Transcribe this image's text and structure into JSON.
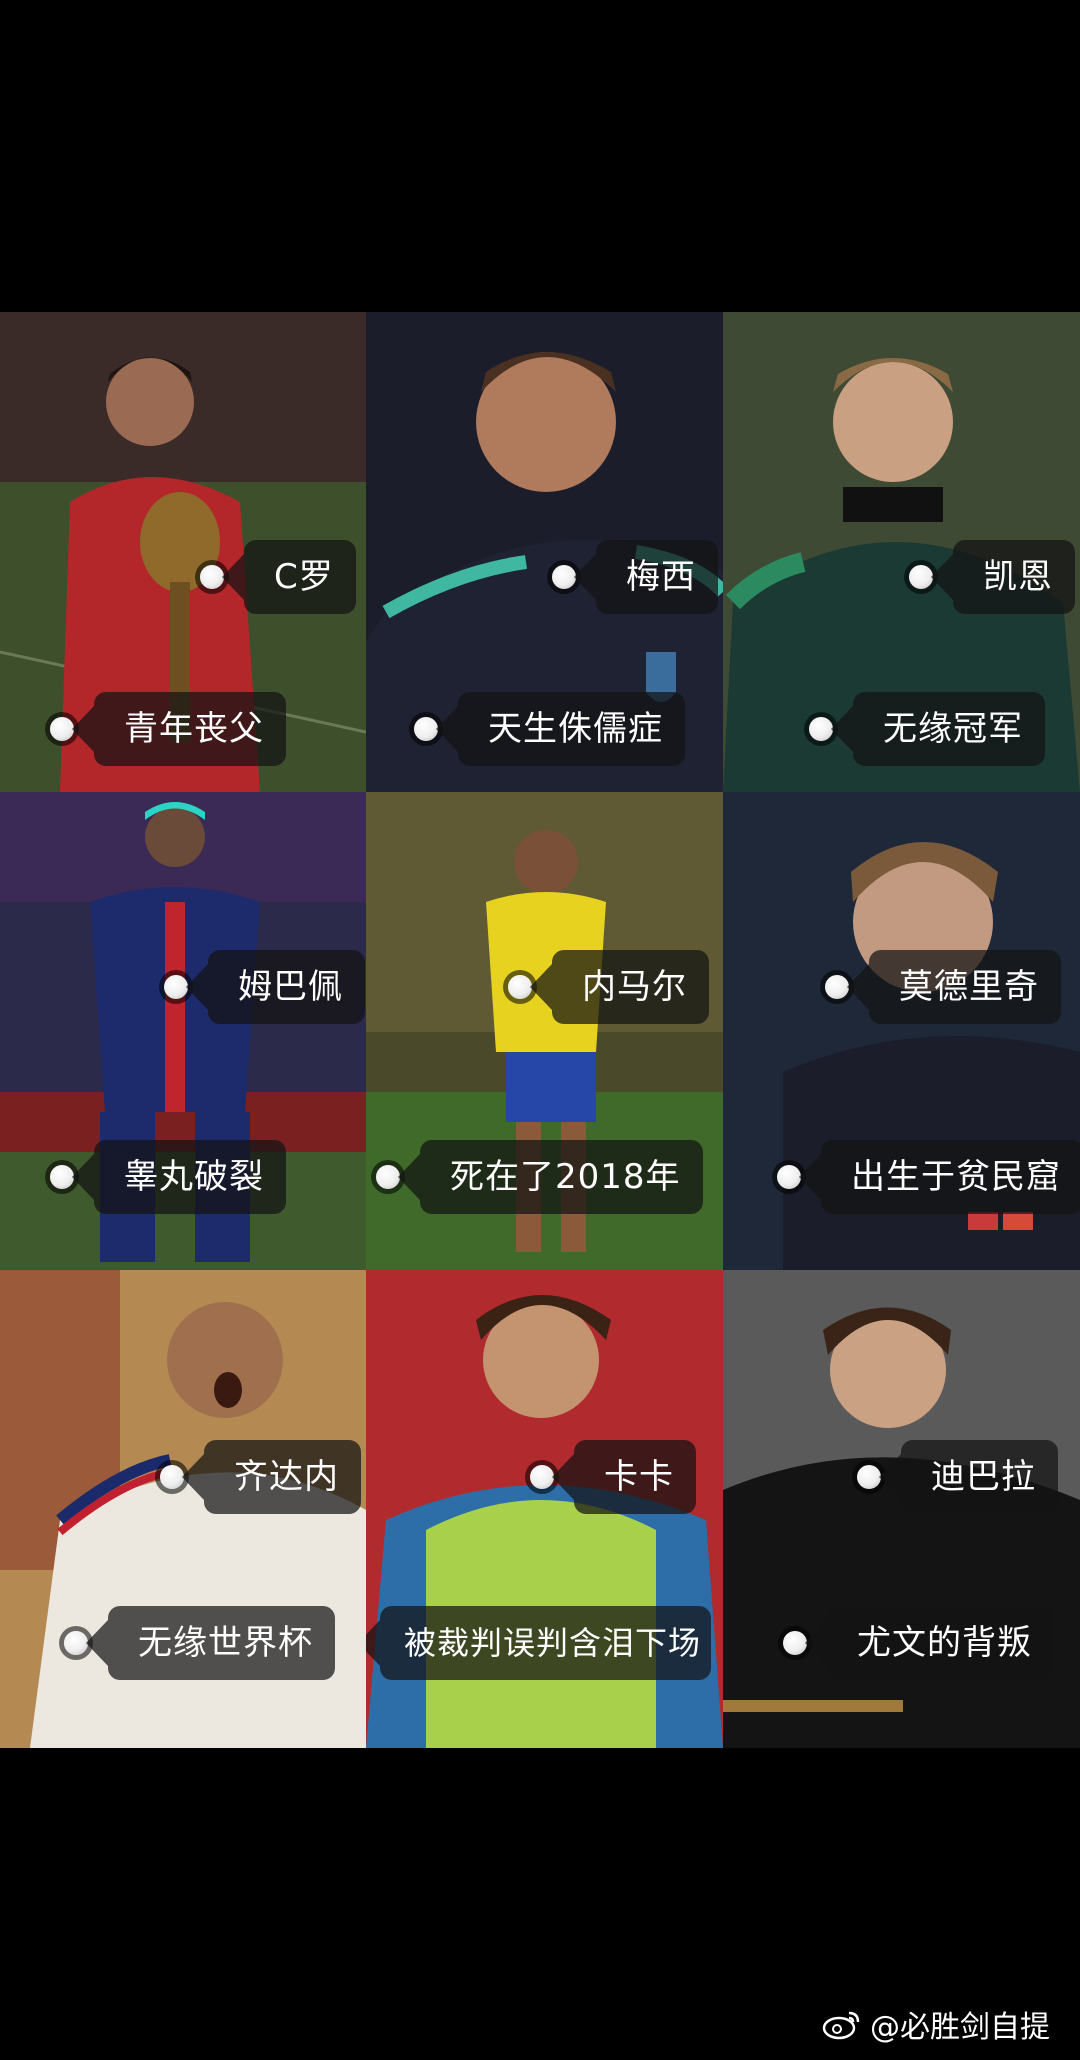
{
  "players": [
    {
      "name": "C罗",
      "story": "青年丧父"
    },
    {
      "name": "梅西",
      "story": "天生侏儒症"
    },
    {
      "name": "凯恩",
      "story": "无缘冠军"
    },
    {
      "name": "姆巴佩",
      "story": "睾丸破裂"
    },
    {
      "name": "内马尔",
      "story": "死在了2018年"
    },
    {
      "name": "莫德里奇",
      "story": "出生于贫民窟"
    },
    {
      "name": "齐达内",
      "story": "无缘世界杯"
    },
    {
      "name": "卡卡",
      "story": "被裁判误判含泪下场"
    },
    {
      "name": "迪巴拉",
      "story": "尤文的背叛"
    }
  ],
  "watermark": {
    "text": "@必胜剑自提",
    "icon": "weibo-icon"
  },
  "colors": {
    "background": "#000000",
    "tag_bg": "rgba(20,20,20,0.72)"
  }
}
